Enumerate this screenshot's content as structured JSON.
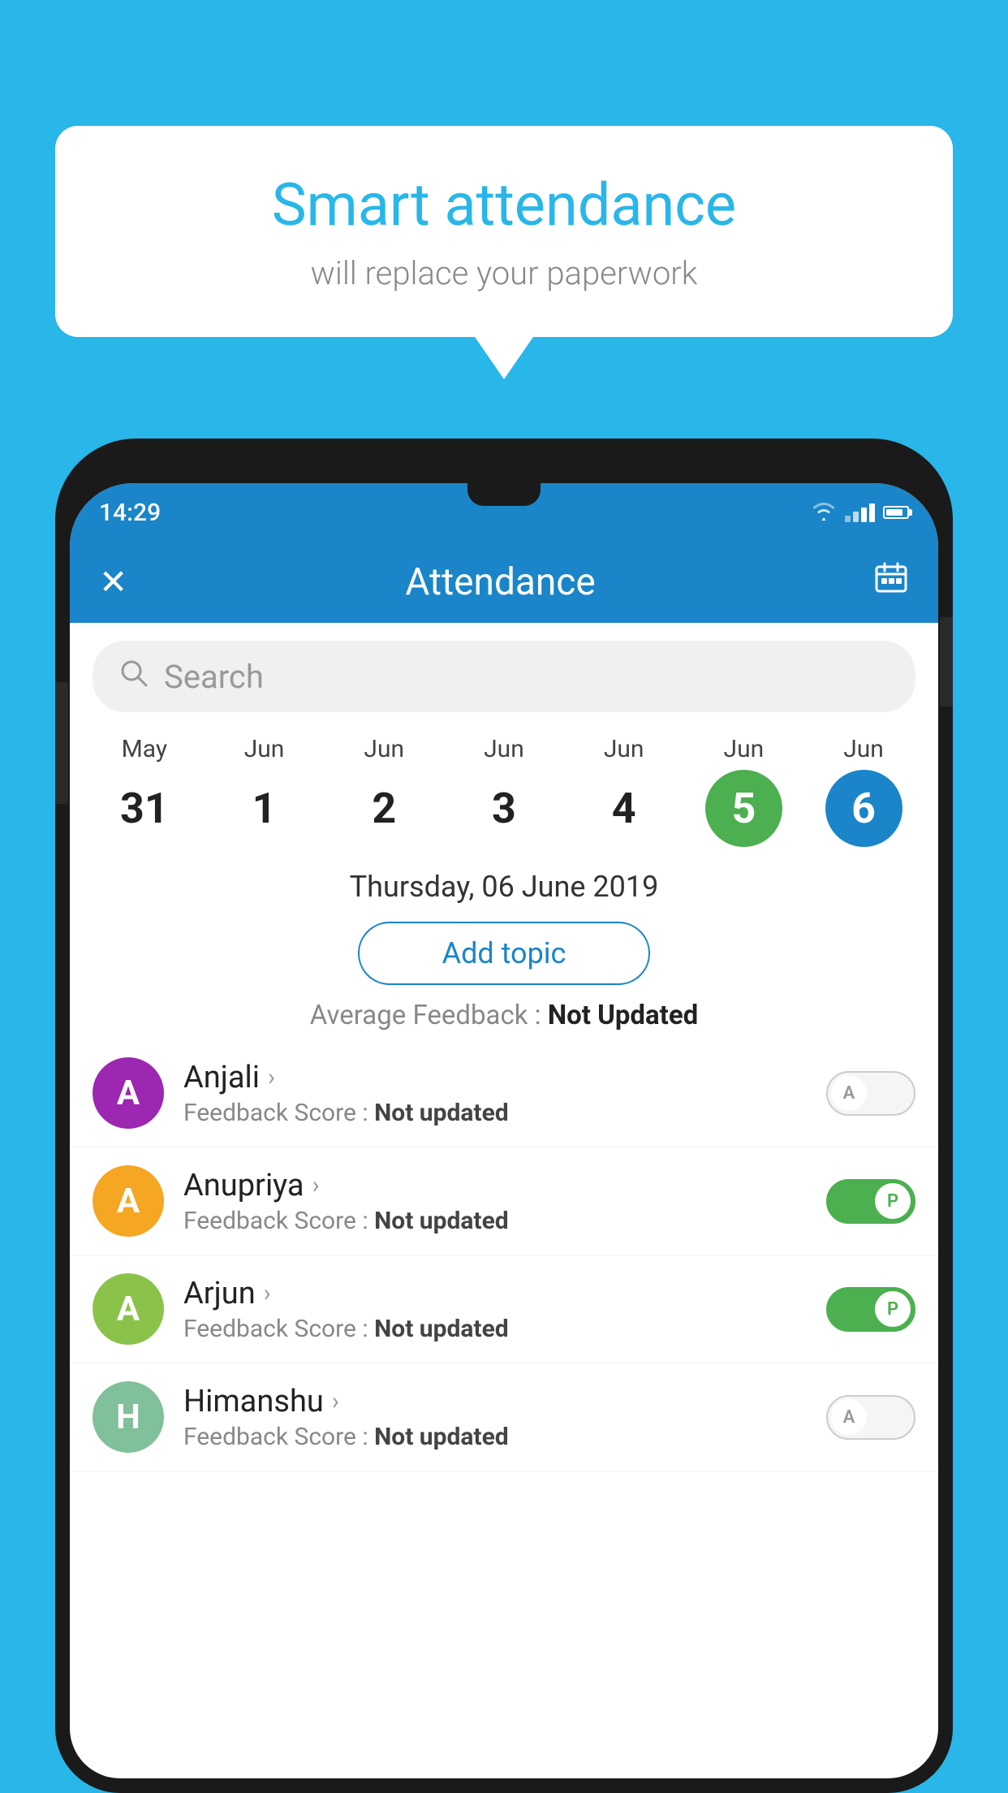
{
  "background_color": "#29b6e8",
  "bubble": {
    "title": "Smart attendance",
    "subtitle": "will replace your paperwork"
  },
  "status_bar": {
    "time": "14:29",
    "wifi": "wifi",
    "signal": "signal",
    "battery": "battery"
  },
  "header": {
    "close_label": "✕",
    "title": "Attendance",
    "calendar_icon": "calendar"
  },
  "search": {
    "placeholder": "Search"
  },
  "calendar": {
    "days": [
      {
        "month": "May",
        "date": "31",
        "style": "normal"
      },
      {
        "month": "Jun",
        "date": "1",
        "style": "normal"
      },
      {
        "month": "Jun",
        "date": "2",
        "style": "normal"
      },
      {
        "month": "Jun",
        "date": "3",
        "style": "normal"
      },
      {
        "month": "Jun",
        "date": "4",
        "style": "normal"
      },
      {
        "month": "Jun",
        "date": "5",
        "style": "today"
      },
      {
        "month": "Jun",
        "date": "6",
        "style": "selected"
      }
    ]
  },
  "selected_date": "Thursday, 06 June 2019",
  "add_topic_label": "Add topic",
  "feedback_prefix": "Average Feedback : ",
  "feedback_value": "Not Updated",
  "students": [
    {
      "name": "Anjali",
      "avatar_letter": "A",
      "avatar_color": "purple",
      "score_label": "Feedback Score : ",
      "score_value": "Not updated",
      "toggle": "off",
      "toggle_letter": "A"
    },
    {
      "name": "Anupriya",
      "avatar_letter": "A",
      "avatar_color": "orange",
      "score_label": "Feedback Score : ",
      "score_value": "Not updated",
      "toggle": "on",
      "toggle_letter": "P"
    },
    {
      "name": "Arjun",
      "avatar_letter": "A",
      "avatar_color": "green",
      "score_label": "Feedback Score : ",
      "score_value": "Not updated",
      "toggle": "on",
      "toggle_letter": "P"
    },
    {
      "name": "Himanshu",
      "avatar_letter": "H",
      "avatar_color": "teal",
      "score_label": "Feedback Score : ",
      "score_value": "Not updated",
      "toggle": "off",
      "toggle_letter": "A"
    }
  ]
}
